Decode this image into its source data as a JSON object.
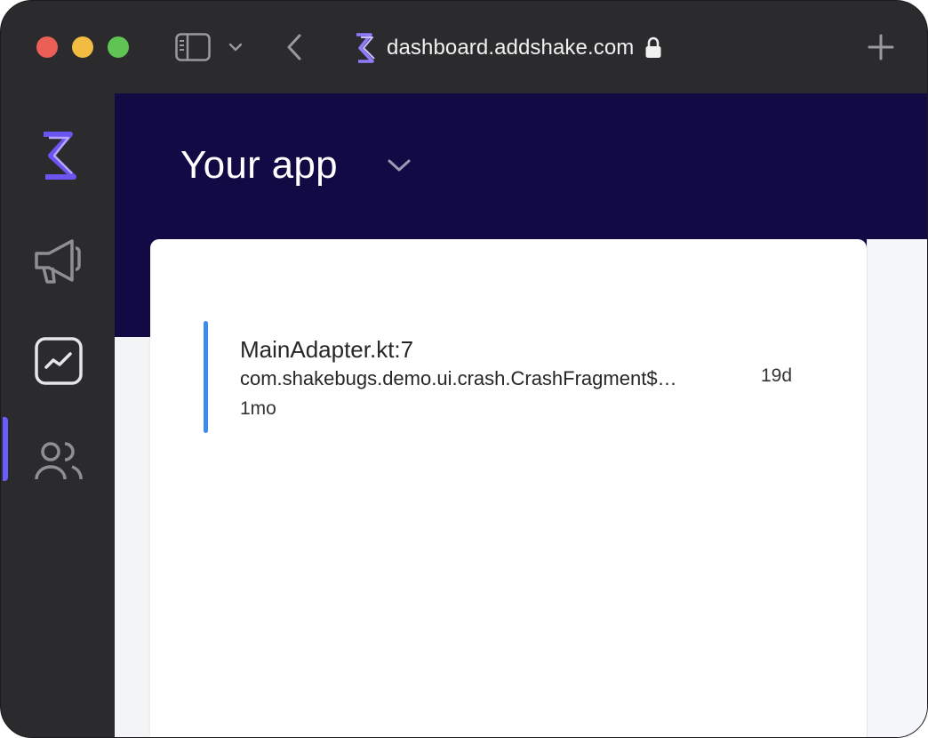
{
  "browser": {
    "url": "dashboard.addshake.com"
  },
  "header": {
    "app_title": "Your app"
  },
  "crash_list": {
    "items": [
      {
        "title": "MainAdapter.kt:7",
        "subtitle": "com.shakebugs.demo.ui.crash.CrashFragment$…",
        "last_seen": "19d",
        "first_seen": "1mo"
      }
    ]
  },
  "icons": {
    "sidebar": [
      "shake-logo-icon",
      "megaphone-icon",
      "chart-icon",
      "users-icon"
    ],
    "titlebar": [
      "sidebar-toggle-icon",
      "chevron-down-icon",
      "back-icon",
      "lock-icon",
      "new-tab-icon"
    ]
  },
  "colors": {
    "header_bg": "#120a45",
    "accent": "#6a5cff",
    "crash_bar": "#3b8cf0",
    "chrome_bg": "#2b2b2e"
  }
}
